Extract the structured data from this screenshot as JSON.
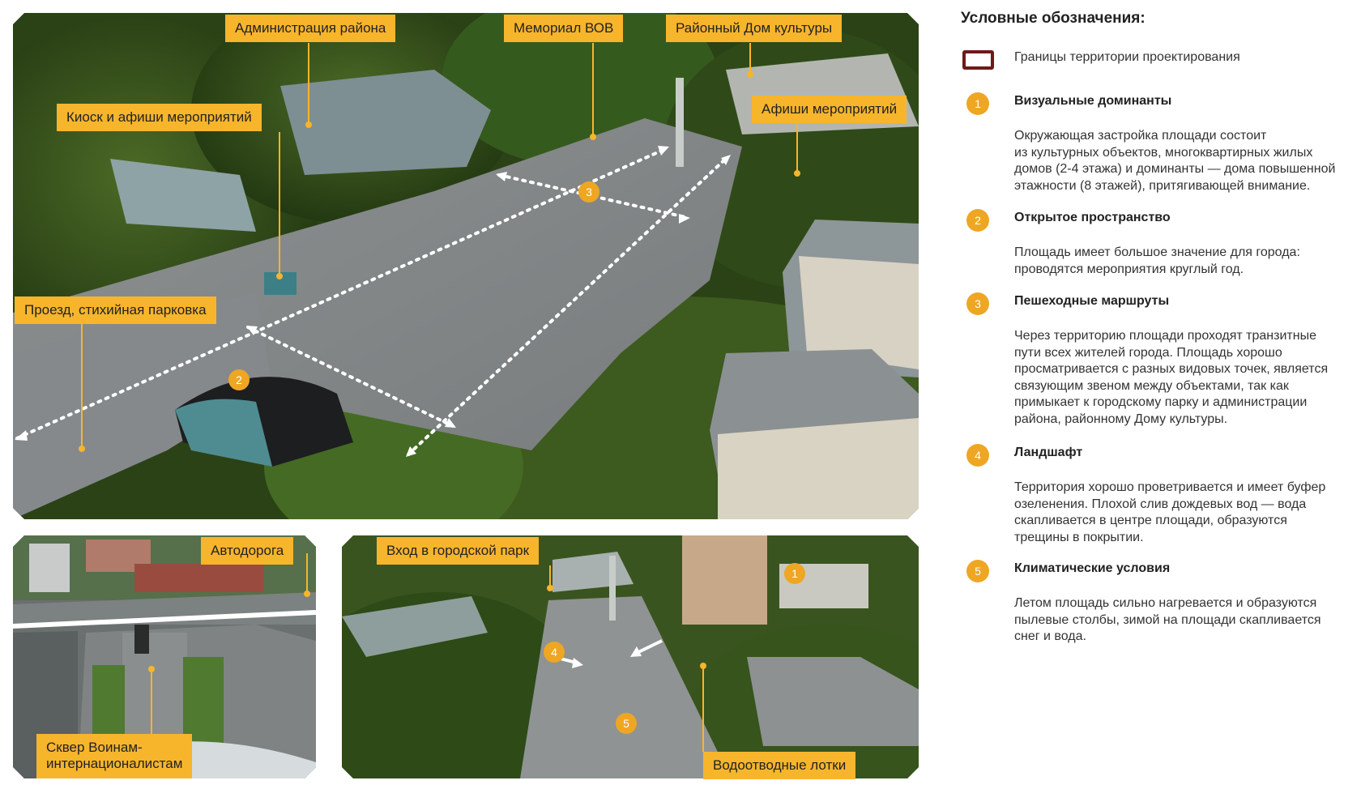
{
  "callouts": {
    "admin": "Администрация района",
    "memorial": "Мемориал ВОВ",
    "culture_house": "Районный Дом культуры",
    "kiosk": "Киоск и афиши мероприятий",
    "posters": "Афиши мероприятий",
    "parking": "Проезд, стихийная парковка",
    "road": "Автодорога",
    "square": "Сквер Воинам-\nинтернационалистам",
    "park_entrance": "Вход в городской парк",
    "drains": "Водоотводные лотки"
  },
  "photo_badges": {
    "main": [
      "2",
      "3"
    ],
    "park": [
      "1",
      "4",
      "5"
    ]
  },
  "legend": {
    "title": "Условные обозначения:",
    "boundary_label": "Границы территории проектирования",
    "boundary_color": "#6d1a1a",
    "badge_color": "#eea623",
    "items": [
      {
        "num": "1",
        "title": "Визуальные доминанты",
        "text": "Окружающая застройка площади состоит\nиз культурных объектов, многоквартирных жилых\nдомов (2-4 этажа) и доминанты — дома повышенной\nэтажности (8 этажей), притягивающей внимание."
      },
      {
        "num": "2",
        "title": "Открытое пространство",
        "text": "Площадь имеет большое значение для города:\nпроводятся мероприятия круглый год."
      },
      {
        "num": "3",
        "title": "Пешеходные маршруты",
        "text": "Через территорию площади проходят транзитные\nпути всех жителей города. Площадь хорошо\nпросматривается с разных видовых точек, является\nсвязующим звеном между объектами, так как\nпримыкает к городскому парку и администрации\nрайона, районному Дому культуры."
      },
      {
        "num": "4",
        "title": "Ландшафт",
        "text": "Территория хорошо проветривается и имеет буфер\nозеленения. Плохой слив дождевых вод — вода\nскапливается в центре площади, образуются\nтрещины в покрытии."
      },
      {
        "num": "5",
        "title": "Климатические условия",
        "text": "Летом площадь сильно нагревается и образуются\nпылевые столбы, зимой на площади скапливается\nснег и вода."
      }
    ]
  }
}
